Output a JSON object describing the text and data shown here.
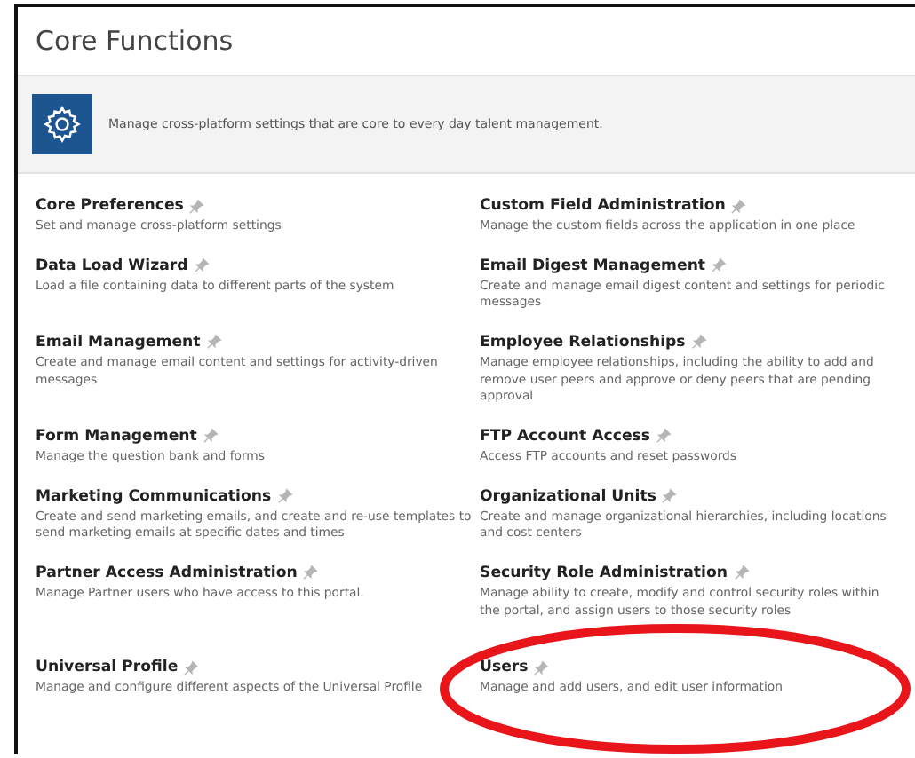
{
  "panel": {
    "title": "Core Functions"
  },
  "banner": {
    "text": "Manage cross-platform settings that are core to every day talent management."
  },
  "functions": [
    {
      "name": "Core Preferences",
      "pinned": false,
      "description": "Set and manage cross-platform settings"
    },
    {
      "name": "Custom Field Administration",
      "pinned": false,
      "description": "Manage the custom fields across the application in one place"
    },
    {
      "name": "Data Load Wizard",
      "pinned": false,
      "description": "Load a file containing data to different parts of the system"
    },
    {
      "name": "Email Digest Management",
      "pinned": false,
      "description": "Create and manage email digest content and settings for periodic messages"
    },
    {
      "name": "Email Management",
      "pinned": false,
      "description": "Create and manage email content and settings for activity-driven messages"
    },
    {
      "name": "Employee Relationships",
      "pinned": false,
      "description": "Manage employee relationships, including the ability to add and remove user peers and approve or deny peers that are pending approval"
    },
    {
      "name": "Form Management",
      "pinned": false,
      "description": "Manage the question bank and forms"
    },
    {
      "name": "FTP Account Access",
      "pinned": false,
      "description": "Access FTP accounts and reset passwords"
    },
    {
      "name": "Marketing Communications",
      "pinned": false,
      "description": "Create and send marketing emails, and create and re-use templates to send marketing emails at specific dates and times"
    },
    {
      "name": "Organizational Units",
      "pinned": false,
      "description": "Create and manage organizational hierarchies, including locations and cost centers"
    },
    {
      "name": "Partner Access Administration",
      "pinned": false,
      "description": "Manage Partner users who have access to this portal."
    },
    {
      "name": "Security Role Administration",
      "pinned": false,
      "description": "Manage ability to create, modify and control security roles within the portal, and assign users to those security roles"
    },
    {
      "name": "Universal Profile",
      "pinned": false,
      "description": "Manage and configure different aspects of the Universal Profile"
    },
    {
      "name": "Users",
      "pinned": false,
      "description": "Manage and add users, and edit user information"
    }
  ]
}
